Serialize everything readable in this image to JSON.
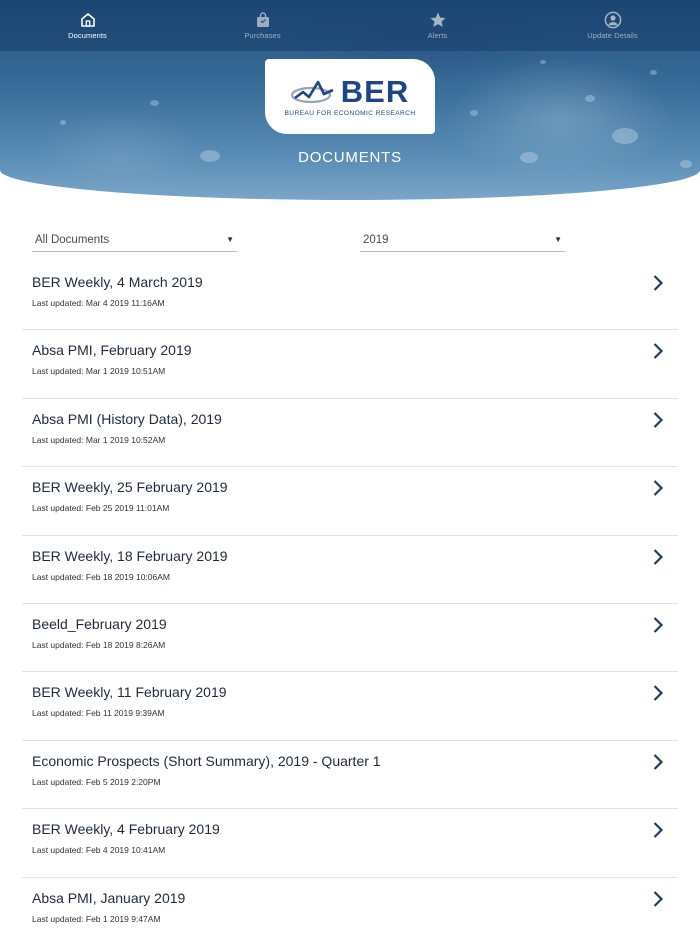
{
  "nav": {
    "items": [
      {
        "label": "Documents",
        "icon": "home-icon",
        "active": true
      },
      {
        "label": "Purchases",
        "icon": "shopping-bag-icon",
        "active": false
      },
      {
        "label": "Alerts",
        "icon": "star-icon",
        "active": false
      },
      {
        "label": "Update Details",
        "icon": "user-circle-icon",
        "active": false
      }
    ]
  },
  "logo": {
    "name": "BER",
    "subtitle": "BUREAU FOR ECONOMIC RESEARCH"
  },
  "page": {
    "title": "DOCUMENTS"
  },
  "filters": {
    "type": {
      "value": "All Documents"
    },
    "year": {
      "value": "2019"
    }
  },
  "documents": [
    {
      "title": "BER Weekly, 4 March 2019",
      "updated": "Last updated: Mar 4 2019 11:16AM"
    },
    {
      "title": "Absa PMI, February 2019",
      "updated": "Last updated: Mar 1 2019 10:51AM"
    },
    {
      "title": "Absa PMI (History Data), 2019",
      "updated": "Last updated: Mar 1 2019 10:52AM"
    },
    {
      "title": "BER Weekly, 25 February 2019",
      "updated": "Last updated: Feb 25 2019 11:01AM"
    },
    {
      "title": "BER Weekly, 18 February 2019",
      "updated": "Last updated: Feb 18 2019 10:06AM"
    },
    {
      "title": "Beeld_February 2019",
      "updated": "Last updated: Feb 18 2019 8:26AM"
    },
    {
      "title": "BER Weekly, 11 February 2019",
      "updated": "Last updated: Feb 11 2019 9:39AM"
    },
    {
      "title": "Economic Prospects (Short Summary), 2019 - Quarter 1",
      "updated": "Last updated: Feb 5 2019 2:20PM"
    },
    {
      "title": "BER Weekly, 4 February 2019",
      "updated": "Last updated: Feb 4 2019 10:41AM"
    },
    {
      "title": "Absa PMI, January 2019",
      "updated": "Last updated: Feb 1 2019 9:47AM"
    }
  ],
  "colors": {
    "brand": "#1d4587",
    "header": "#22507f",
    "chevron": "#1f3b66"
  }
}
